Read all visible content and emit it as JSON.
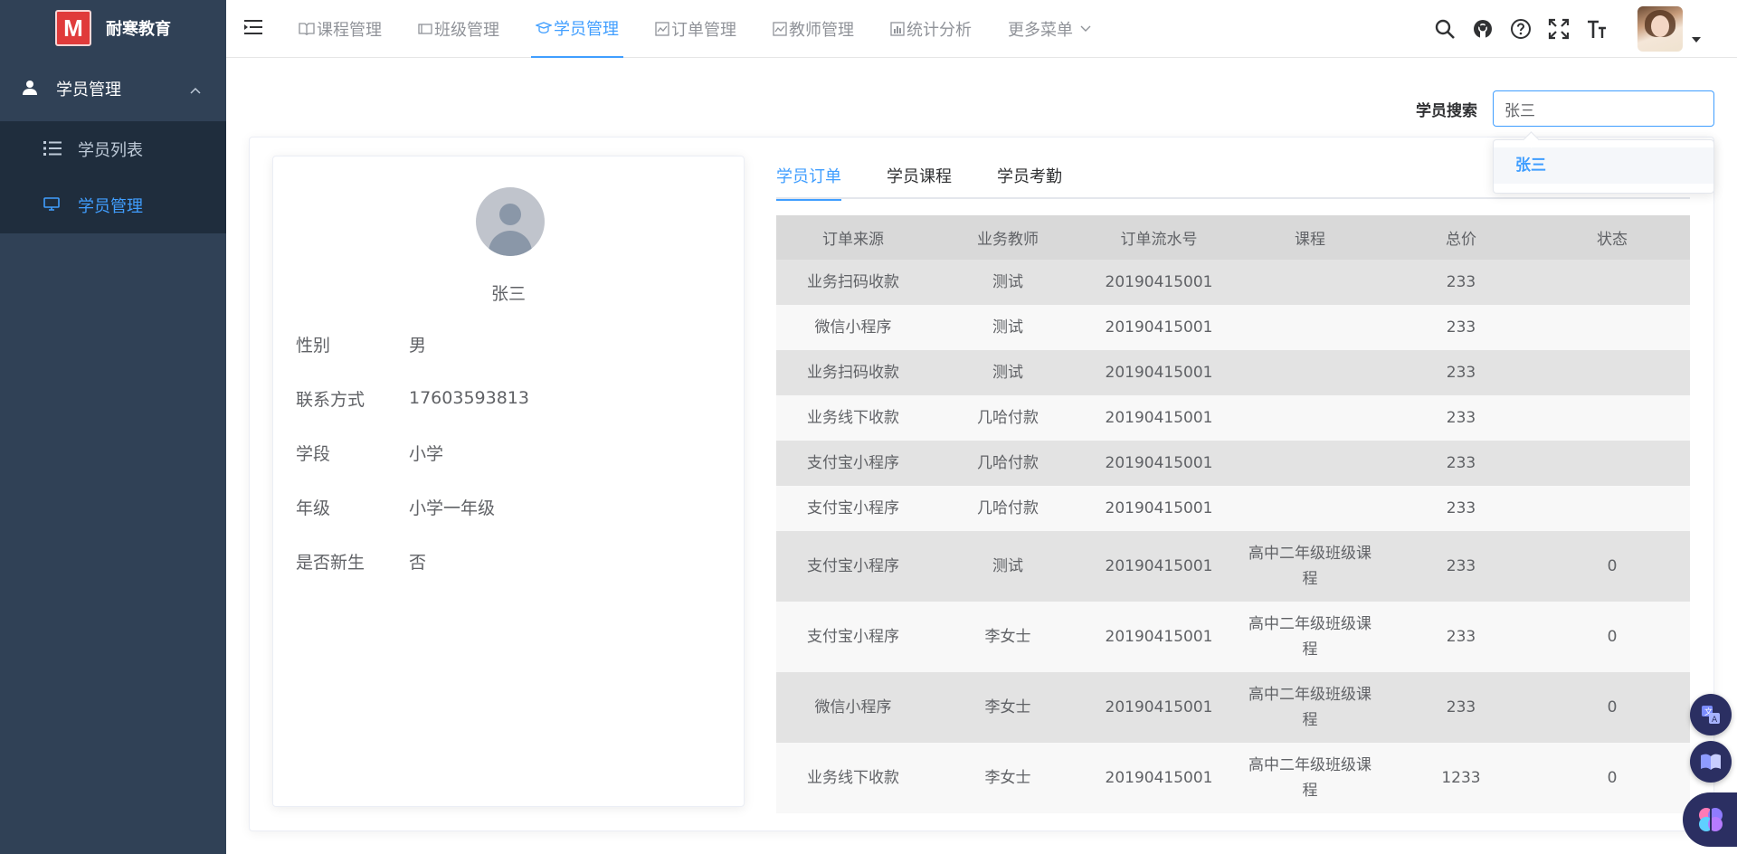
{
  "app": {
    "logo_letter": "M",
    "logo_text": "耐寒教育"
  },
  "sidebar": {
    "group_label": "学员管理",
    "items": [
      {
        "label": "学员列表",
        "icon": "list-icon",
        "active": false
      },
      {
        "label": "学员管理",
        "icon": "monitor-icon",
        "active": true
      }
    ]
  },
  "topnav": {
    "items": [
      {
        "label": "课程管理",
        "icon": "book-icon"
      },
      {
        "label": "班级管理",
        "icon": "tag-icon"
      },
      {
        "label": "学员管理",
        "icon": "graduate-icon",
        "active": true
      },
      {
        "label": "订单管理",
        "icon": "chart-icon"
      },
      {
        "label": "教师管理",
        "icon": "chart-icon"
      },
      {
        "label": "统计分析",
        "icon": "bars-icon"
      }
    ],
    "more_label": "更多菜单"
  },
  "tools": [
    "search-icon",
    "github-icon",
    "help-icon",
    "fullscreen-icon",
    "font-size-icon"
  ],
  "search": {
    "label": "学员搜索",
    "value": "张三",
    "suggestion": "张三"
  },
  "profile": {
    "name": "张三",
    "fields": [
      {
        "key": "性别",
        "value": "男"
      },
      {
        "key": "联系方式",
        "value": "17603593813"
      },
      {
        "key": "学段",
        "value": "小学"
      },
      {
        "key": "年级",
        "value": "小学一年级"
      },
      {
        "key": "是否新生",
        "value": "否"
      }
    ]
  },
  "tabs": [
    "学员订单",
    "学员课程",
    "学员考勤"
  ],
  "table": {
    "headers": [
      "订单来源",
      "业务教师",
      "订单流水号",
      "课程",
      "总价",
      "状态"
    ],
    "rows": [
      [
        "业务扫码收款",
        "测试",
        "20190415001",
        "",
        "233",
        ""
      ],
      [
        "微信小程序",
        "测试",
        "20190415001",
        "",
        "233",
        ""
      ],
      [
        "业务扫码收款",
        "测试",
        "20190415001",
        "",
        "233",
        ""
      ],
      [
        "业务线下收款",
        "几哈付款",
        "20190415001",
        "",
        "233",
        ""
      ],
      [
        "支付宝小程序",
        "几哈付款",
        "20190415001",
        "",
        "233",
        ""
      ],
      [
        "支付宝小程序",
        "几哈付款",
        "20190415001",
        "",
        "233",
        ""
      ],
      [
        "支付宝小程序",
        "测试",
        "20190415001",
        "高中二年级班级课程",
        "233",
        "0"
      ],
      [
        "支付宝小程序",
        "李女士",
        "20190415001",
        "高中二年级班级课程",
        "233",
        "0"
      ],
      [
        "微信小程序",
        "李女士",
        "20190415001",
        "高中二年级班级课程",
        "233",
        "0"
      ],
      [
        "业务线下收款",
        "李女士",
        "20190415001",
        "高中二年级班级课程",
        "1233",
        "0"
      ]
    ]
  },
  "colors": {
    "accent": "#409eff",
    "sidebar_bg": "#304156",
    "submenu_bg": "#1f2d3d"
  }
}
